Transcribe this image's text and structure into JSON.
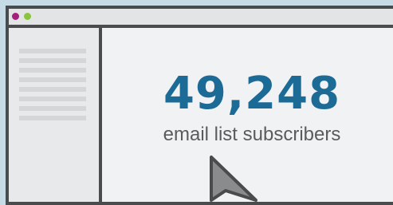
{
  "window": {
    "controls": [
      "close",
      "minimize"
    ],
    "colors": {
      "close": "#a61f7a",
      "minimize": "#8bc43f",
      "frame": "#4a4b4d"
    }
  },
  "stat": {
    "value": "49,248",
    "label": "email list subscribers",
    "value_color": "#1c6b96"
  },
  "icons": {
    "pointer": "cursor-arrow-icon"
  }
}
